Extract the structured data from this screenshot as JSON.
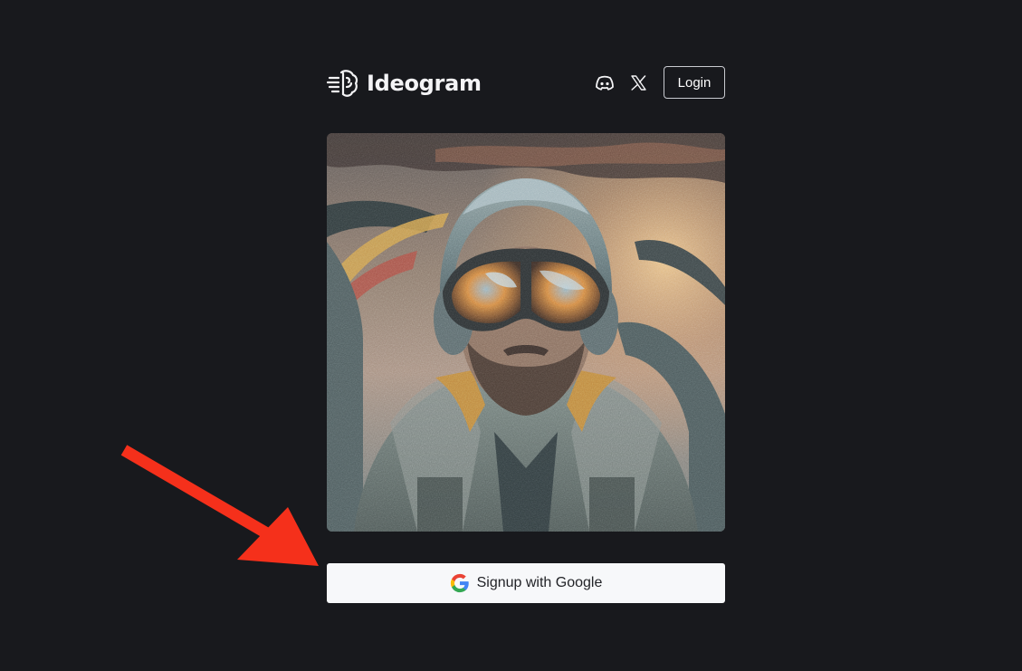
{
  "header": {
    "brand": "Ideogram",
    "icons": [
      "brain-logo-icon",
      "discord-icon",
      "x-icon"
    ],
    "login_label": "Login"
  },
  "hero": {
    "image": "pilot-portrait-image"
  },
  "signup": {
    "label": "Signup with Google",
    "icon": "google-icon"
  },
  "annotation": {
    "type": "arrow",
    "color": "#f5301b"
  },
  "colors": {
    "background": "#18191d",
    "button_bg": "#f7f8fa",
    "text_light": "#f4f4f6",
    "arrow": "#f5301b"
  }
}
